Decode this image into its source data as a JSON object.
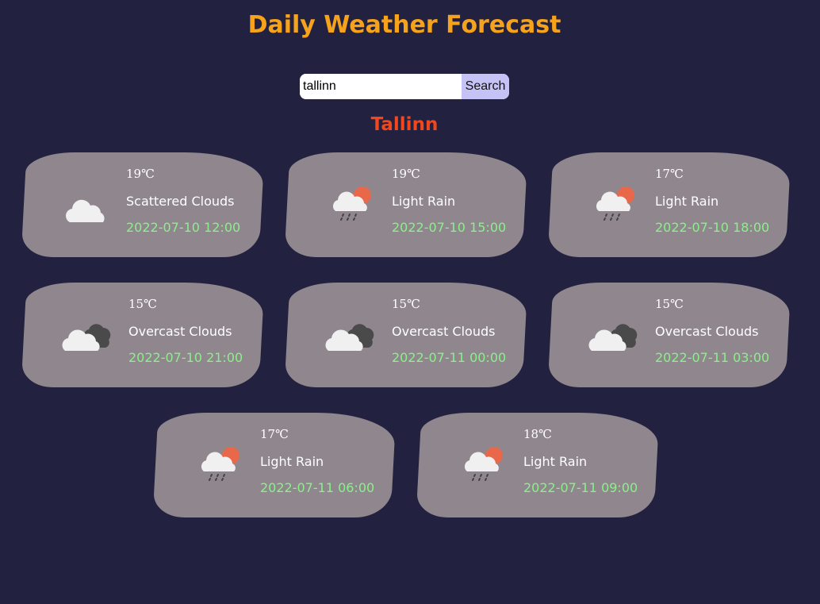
{
  "header": {
    "title": "Daily Weather Forecast"
  },
  "search": {
    "value": "tallinn",
    "button_label": "Search"
  },
  "city": "Tallinn",
  "colors": {
    "background": "#222240",
    "title": "#f7a21b",
    "city": "#f2461c",
    "card": "#8f868e",
    "time": "#8cf08a"
  },
  "forecasts": [
    {
      "temp": "19℃",
      "description": "Scattered Clouds",
      "time": "2022-07-10 12:00",
      "icon": "scattered-clouds-icon"
    },
    {
      "temp": "19℃",
      "description": "Light Rain",
      "time": "2022-07-10 15:00",
      "icon": "light-rain-icon"
    },
    {
      "temp": "17℃",
      "description": "Light Rain",
      "time": "2022-07-10 18:00",
      "icon": "light-rain-icon"
    },
    {
      "temp": "15℃",
      "description": "Overcast Clouds",
      "time": "2022-07-10 21:00",
      "icon": "overcast-clouds-icon"
    },
    {
      "temp": "15℃",
      "description": "Overcast Clouds",
      "time": "2022-07-11 00:00",
      "icon": "overcast-clouds-icon"
    },
    {
      "temp": "15℃",
      "description": "Overcast Clouds",
      "time": "2022-07-11 03:00",
      "icon": "overcast-clouds-icon"
    },
    {
      "temp": "17℃",
      "description": "Light Rain",
      "time": "2022-07-11 06:00",
      "icon": "light-rain-icon"
    },
    {
      "temp": "18℃",
      "description": "Light Rain",
      "time": "2022-07-11 09:00",
      "icon": "light-rain-icon"
    }
  ]
}
